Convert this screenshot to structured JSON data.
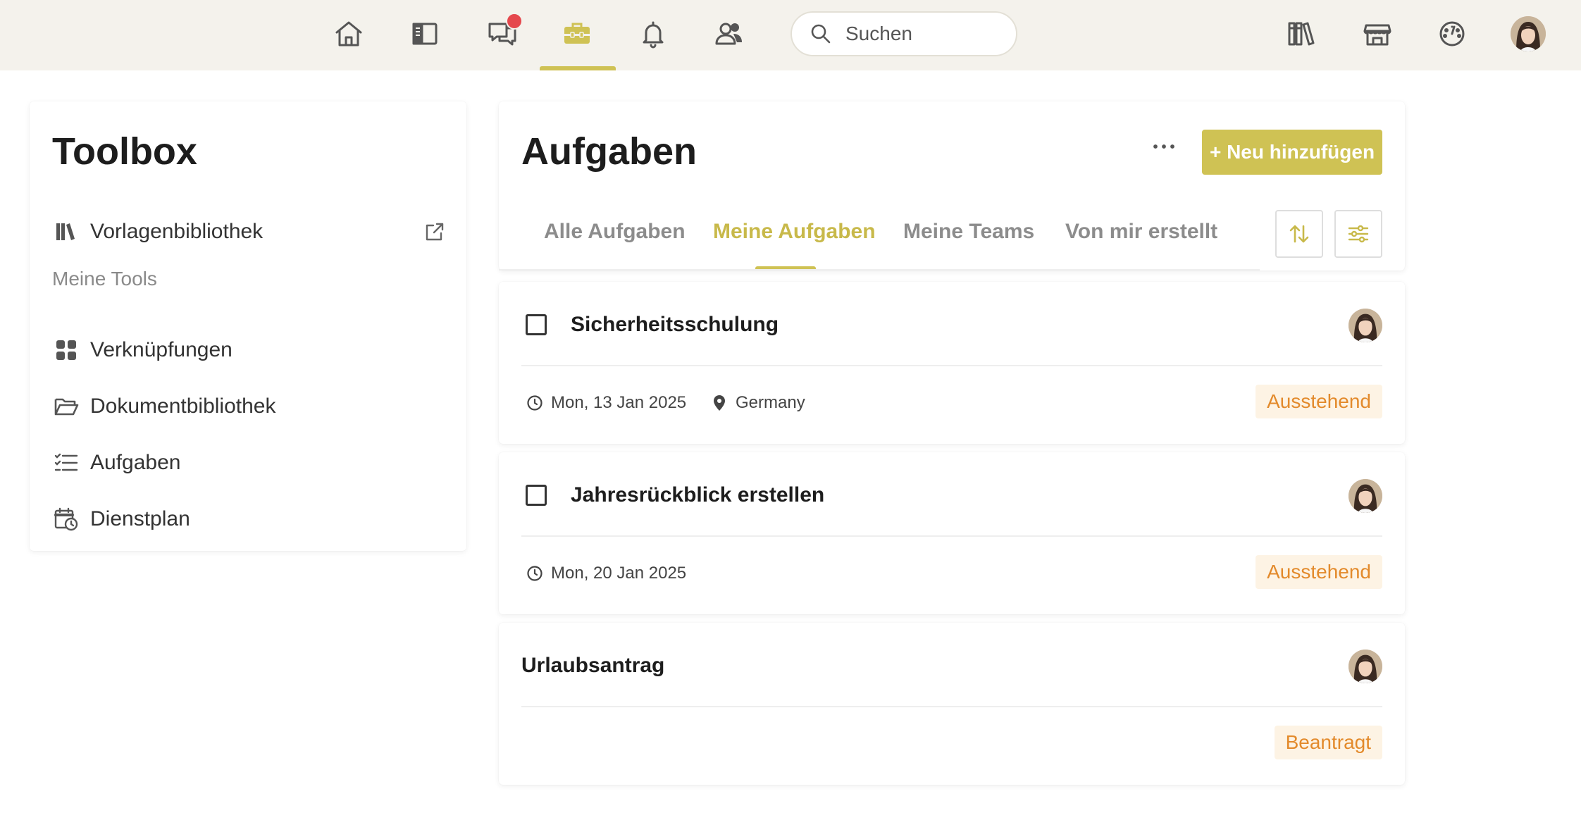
{
  "colors": {
    "accent": "#cfc254",
    "notification": "#e5484d",
    "status_text": "#e38a2b",
    "status_bg": "#fdf3e4",
    "topbar_bg": "#f4f2ec"
  },
  "topnav": {
    "icons": [
      "home-icon",
      "sidebar-panel-icon",
      "chat-icon",
      "toolbox-icon",
      "bell-icon",
      "users-icon"
    ],
    "active": "toolbox-icon",
    "search_placeholder": "Suchen",
    "right_icons": [
      "library-icon",
      "store-icon",
      "dashboard-gauge-icon",
      "user-avatar"
    ]
  },
  "toolbox": {
    "title": "Toolbox",
    "template_library": "Vorlagenbibliothek",
    "section_label": "Meine Tools",
    "items": [
      {
        "label": "Verknüpfungen",
        "icon": "grid-icon"
      },
      {
        "label": "Dokumentbibliothek",
        "icon": "folder-icon"
      },
      {
        "label": "Aufgaben",
        "icon": "checklist-icon"
      },
      {
        "label": "Dienstplan",
        "icon": "calendar-clock-icon"
      }
    ]
  },
  "main": {
    "title": "Aufgaben",
    "add_label": "+ Neu hinzufügen",
    "tabs": [
      {
        "label": "Alle Aufgaben"
      },
      {
        "label": "Meine Aufgaben"
      },
      {
        "label": "Meine Teams"
      },
      {
        "label": "Von mir erstellt"
      }
    ],
    "active_tab": "Meine Aufgaben"
  },
  "tasks": [
    {
      "title": "Sicherheitsschulung",
      "date": "Mon, 13 Jan 2025",
      "location": "Germany",
      "status": "Ausstehend"
    },
    {
      "title": "Jahresrückblick erstellen",
      "date": "Mon, 20 Jan 2025",
      "status": "Ausstehend"
    },
    {
      "title": "Urlaubsantrag",
      "status": "Beantragt"
    }
  ]
}
